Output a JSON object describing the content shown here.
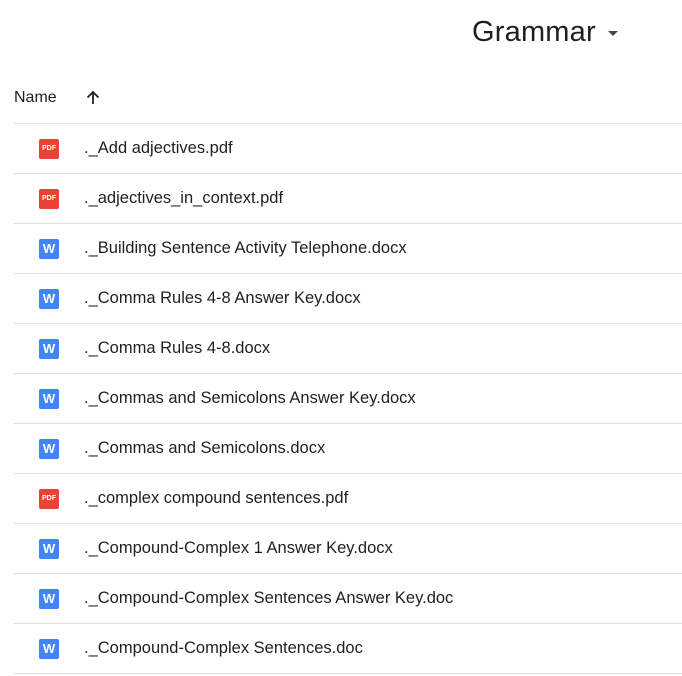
{
  "folder": {
    "title": "Grammar"
  },
  "header": {
    "name_label": "Name"
  },
  "icons": {
    "pdf_label": "PDF",
    "word_label": "W"
  },
  "files": [
    {
      "name": "._Add adjectives.pdf",
      "type": "pdf"
    },
    {
      "name": "._adjectives_in_context.pdf",
      "type": "pdf"
    },
    {
      "name": "._Building Sentence Activity Telephone.docx",
      "type": "word"
    },
    {
      "name": "._Comma Rules 4-8 Answer Key.docx",
      "type": "word"
    },
    {
      "name": "._Comma Rules 4-8.docx",
      "type": "word"
    },
    {
      "name": "._Commas and Semicolons Answer Key.docx",
      "type": "word"
    },
    {
      "name": "._Commas and Semicolons.docx",
      "type": "word"
    },
    {
      "name": "._complex compound sentences.pdf",
      "type": "pdf"
    },
    {
      "name": "._Compound-Complex 1 Answer Key.docx",
      "type": "word"
    },
    {
      "name": "._Compound-Complex Sentences Answer Key.doc",
      "type": "word"
    },
    {
      "name": "._Compound-Complex Sentences.doc",
      "type": "word"
    }
  ]
}
